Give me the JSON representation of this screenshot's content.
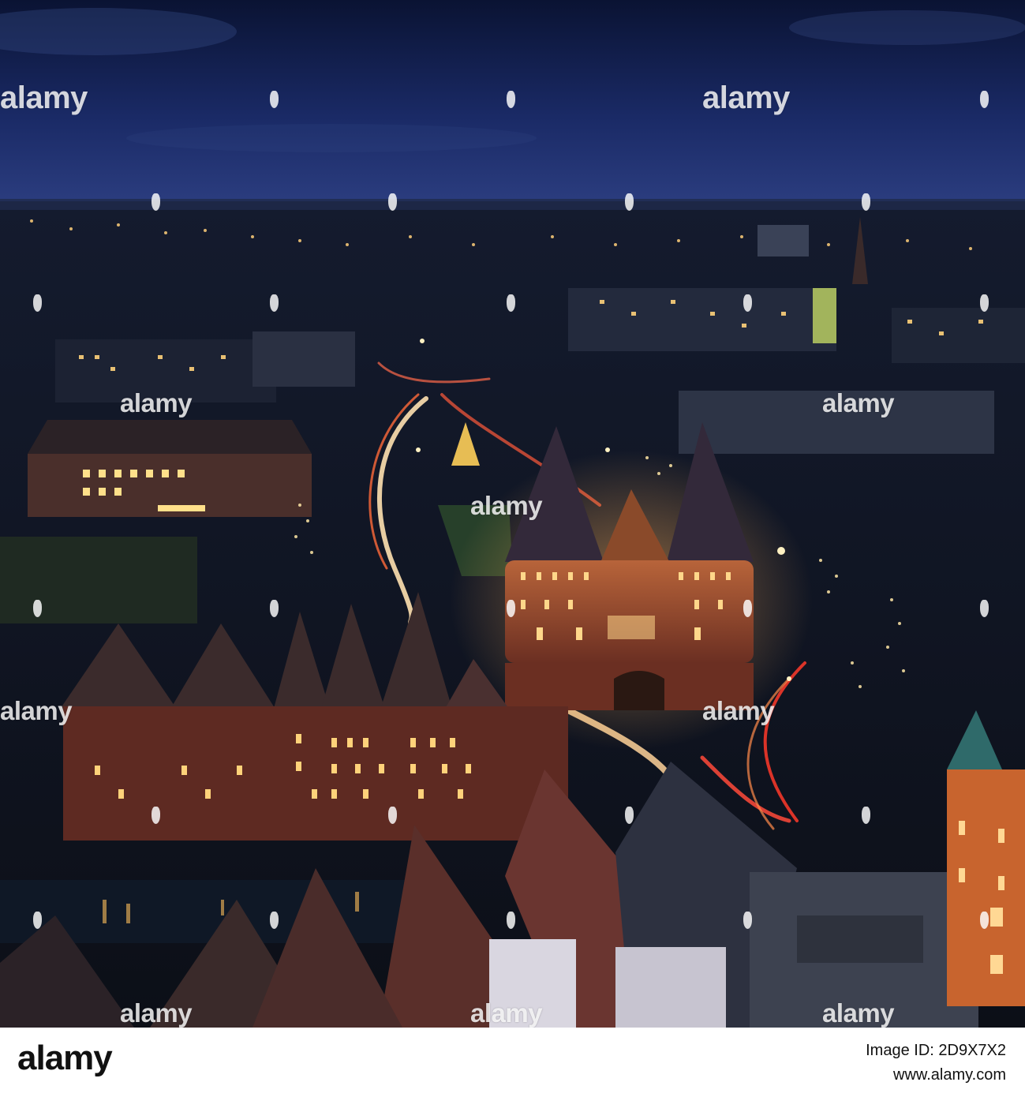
{
  "photo": {
    "description_colors": {
      "sky_top": "#0c163a",
      "sky_horizon": "#2a3f86",
      "city_dark": "#121a2a",
      "warm_light": "#ffb347",
      "brick": "#7a3a2b",
      "roof": "#3a2f34"
    }
  },
  "watermarks": {
    "alamy_1": "alamy",
    "alamy_2": "alamy",
    "alamy_3": "alamy",
    "alamy_4": "alamy",
    "alamy_5": "alamy",
    "alamy_6": "alamy",
    "alamy_7": "alamy",
    "alamy_8": "alamy",
    "alamy_9": "alamy",
    "alamy_10": "alamy"
  },
  "footer": {
    "logo": "alamy",
    "image_id": "Image ID: 2D9X7X2",
    "site": "www.alamy.com"
  }
}
